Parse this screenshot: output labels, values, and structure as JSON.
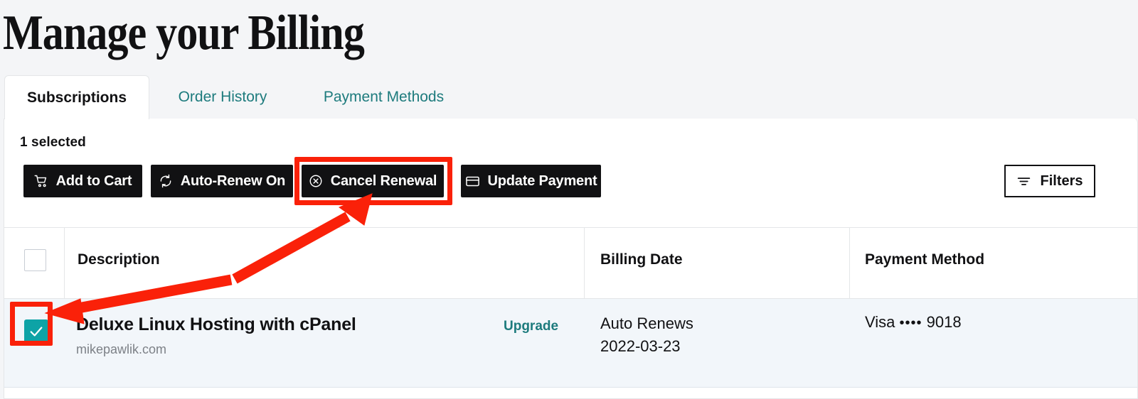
{
  "page": {
    "title": "Manage your Billing",
    "background_color": "#f4f5f7",
    "accent_teal": "#1d7b7d",
    "annotation_color": "#fa2109"
  },
  "tabs": [
    {
      "label": "Subscriptions",
      "active": true
    },
    {
      "label": "Order History",
      "active": false
    },
    {
      "label": "Payment Methods",
      "active": false
    }
  ],
  "toolbar": {
    "selection_status": "1 selected",
    "buttons": [
      {
        "label": "Add to Cart",
        "icon": "shopping-cart-icon"
      },
      {
        "label": "Auto-Renew On",
        "icon": "refresh-cycle-icon"
      },
      {
        "label": "Cancel Renewal",
        "icon": "circle-x-icon"
      },
      {
        "label": "Update Payment",
        "icon": "credit-card-icon"
      }
    ],
    "filters_label": "Filters",
    "filters_icon": "filter-lines-icon"
  },
  "table": {
    "headers": {
      "select_all": "",
      "description": "Description",
      "billing_date": "Billing Date",
      "payment_method": "Payment Method"
    },
    "rows": [
      {
        "selected": true,
        "checkbox_icon": "checkmark-icon",
        "title": "Deluxe Linux Hosting with cPanel",
        "domain": "mikepawlik.com",
        "action_label": "Upgrade",
        "billing_status": "Auto Renews",
        "billing_date": "2022-03-23",
        "payment_brand": "Visa",
        "payment_mask": "••••",
        "payment_last4": "9018"
      }
    ]
  },
  "annotations": {
    "highlight_cancel_renewal": true,
    "highlight_row_checkbox": true,
    "arrow": "double-headed-red-arrow"
  }
}
